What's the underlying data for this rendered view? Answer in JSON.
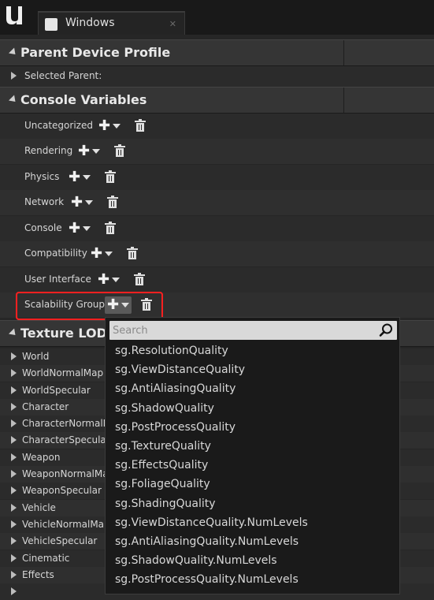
{
  "window": {
    "tab_title": "Windows"
  },
  "parent_device_profile": {
    "title": "Parent Device Profile",
    "selected_parent_label": "Selected Parent:"
  },
  "console_variables": {
    "title": "Console Variables",
    "categories": [
      {
        "label": "Uncategorized"
      },
      {
        "label": "Rendering"
      },
      {
        "label": "Physics"
      },
      {
        "label": "Network"
      },
      {
        "label": "Console"
      },
      {
        "label": "Compatibility"
      },
      {
        "label": "User Interface"
      },
      {
        "label": "Scalability Group"
      }
    ]
  },
  "texture_lod": {
    "title": "Texture LOD S",
    "groups": [
      {
        "label": "World"
      },
      {
        "label": "WorldNormalMap"
      },
      {
        "label": "WorldSpecular"
      },
      {
        "label": "Character"
      },
      {
        "label": "CharacterNormalM"
      },
      {
        "label": "CharacterSpecular"
      },
      {
        "label": "Weapon"
      },
      {
        "label": "WeaponNormalMa"
      },
      {
        "label": "WeaponSpecular"
      },
      {
        "label": "Vehicle"
      },
      {
        "label": "VehicleNormalMap"
      },
      {
        "label": "VehicleSpecular"
      },
      {
        "label": "Cinematic"
      },
      {
        "label": "Effects"
      }
    ]
  },
  "dropdown": {
    "search_placeholder": "Search",
    "items": [
      {
        "label": "sg.ResolutionQuality"
      },
      {
        "label": "sg.ViewDistanceQuality"
      },
      {
        "label": "sg.AntiAliasingQuality"
      },
      {
        "label": "sg.ShadowQuality"
      },
      {
        "label": "sg.PostProcessQuality"
      },
      {
        "label": "sg.TextureQuality"
      },
      {
        "label": "sg.EffectsQuality"
      },
      {
        "label": "sg.FoliageQuality"
      },
      {
        "label": "sg.ShadingQuality"
      },
      {
        "label": "sg.ViewDistanceQuality.NumLevels"
      },
      {
        "label": "sg.AntiAliasingQuality.NumLevels"
      },
      {
        "label": "sg.ShadowQuality.NumLevels"
      },
      {
        "label": "sg.PostProcessQuality.NumLevels"
      }
    ]
  }
}
